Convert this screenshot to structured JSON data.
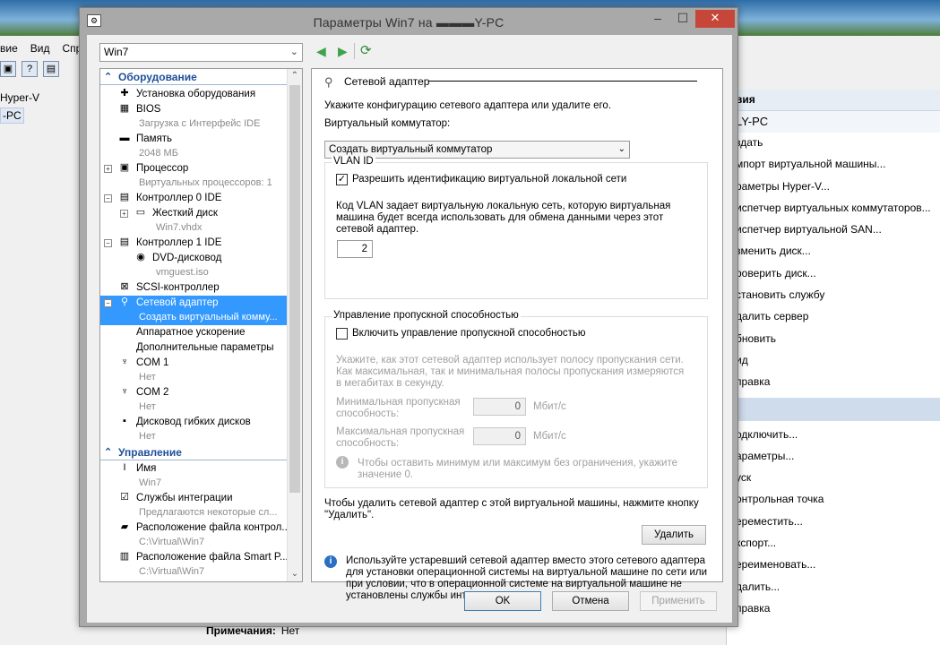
{
  "background": {
    "menu": [
      "вие",
      "Вид",
      "Спр"
    ],
    "tree": [
      "Hyper-V",
      "-PC"
    ],
    "actions_header": "вия",
    "actions_host": "LY-PC",
    "actions": [
      "здать",
      "мпорт виртуальной машины...",
      "раметры Hyper-V...",
      "испетчер виртуальных коммутаторов...",
      "испетчер виртуальной SAN...",
      "зменить диск...",
      "роверить диск...",
      "становить службу",
      "далить сервер",
      "бновить",
      "ид",
      "правка"
    ],
    "actions2": [
      "одключить...",
      "араметры...",
      "уск",
      "онтрольная точка",
      "ереместить...",
      "кспорт...",
      "ереименовать...",
      "далить...",
      "правка"
    ],
    "bottom_label": "Примечания:",
    "bottom_value": "Нет"
  },
  "dialog": {
    "title": "Параметры Win7 на ▬▬▬Y-PC",
    "vm_selected": "Win7"
  },
  "tree": {
    "hardware_header": "Оборудование",
    "management_header": "Управление",
    "items": [
      {
        "label": "Установка оборудования",
        "sub": ""
      },
      {
        "label": "BIOS",
        "sub": "Загрузка с Интерфейс IDE"
      },
      {
        "label": "Память",
        "sub": "2048 МБ"
      },
      {
        "label": "Процессор",
        "sub": "Виртуальных процессоров: 1"
      },
      {
        "label": "Контроллер 0 IDE",
        "sub": ""
      },
      {
        "label": "Жесткий диск",
        "sub": "Win7.vhdx"
      },
      {
        "label": "Контроллер 1 IDE",
        "sub": ""
      },
      {
        "label": "DVD-дисковод",
        "sub": "vmguest.iso"
      },
      {
        "label": "SCSI-контроллер",
        "sub": ""
      },
      {
        "label": "Сетевой адаптер",
        "sub": "Создать виртуальный комму..."
      },
      {
        "label": "Аппаратное ускорение",
        "sub": ""
      },
      {
        "label": "Дополнительные параметры",
        "sub": ""
      },
      {
        "label": "COM 1",
        "sub": "Нет"
      },
      {
        "label": "COM 2",
        "sub": "Нет"
      },
      {
        "label": "Дисковод гибких дисков",
        "sub": "Нет"
      }
    ],
    "mgmt": [
      {
        "label": "Имя",
        "sub": "Win7"
      },
      {
        "label": "Службы интеграции",
        "sub": "Предлагаются некоторые сл..."
      },
      {
        "label": "Расположение файла контрол...",
        "sub": "C:\\Virtual\\Win7"
      },
      {
        "label": "Расположение файла Smart P...",
        "sub": "C:\\Virtual\\Win7"
      }
    ]
  },
  "panel": {
    "heading": "Сетевой адаптер",
    "intro": "Укажите конфигурацию сетевого адаптера или удалите его.",
    "switch_label": "Виртуальный коммутатор:",
    "switch_value": "Создать виртуальный коммутатор",
    "vlan_group": "VLAN ID",
    "vlan_checkbox": "Разрешить идентификацию виртуальной локальной сети",
    "vlan_checked": true,
    "vlan_desc": "Код VLAN задает виртуальную локальную сеть, которую виртуальная машина будет всегда использовать для обмена данными через этот сетевой адаптер.",
    "vlan_value": "2",
    "bw_group": "Управление пропускной способностью",
    "bw_checkbox": "Включить управление пропускной способностью",
    "bw_checked": false,
    "bw_desc": "Укажите, как этот сетевой адаптер использует полосу пропускания сети. Как максимальная, так и минимальная полосы пропускания измеряются в мегабитах в секунду.",
    "min_label": "Минимальная пропускная способность:",
    "min_value": "0",
    "max_label": "Максимальная пропускная способность:",
    "max_value": "0",
    "unit": "Мбит/с",
    "bw_hint": "Чтобы оставить минимум или максимум без ограничения, укажите значение 0.",
    "remove_text": "Чтобы удалить сетевой адаптер с этой виртуальной машины, нажмите кнопку \"Удалить\".",
    "remove_button": "Удалить",
    "legacy_info": "Используйте устаревший сетевой адаптер вместо этого сетевого адаптера для установки операционной системы на виртуальной машине по сети или при условии, что в операционной системе на виртуальной машине не установлены службы интеграции."
  },
  "buttons": {
    "ok": "OK",
    "cancel": "Отмена",
    "apply": "Применить"
  },
  "colors": {
    "selection": "#3399ff",
    "header_text": "#1f4f9a",
    "close_button": "#c7463a"
  }
}
